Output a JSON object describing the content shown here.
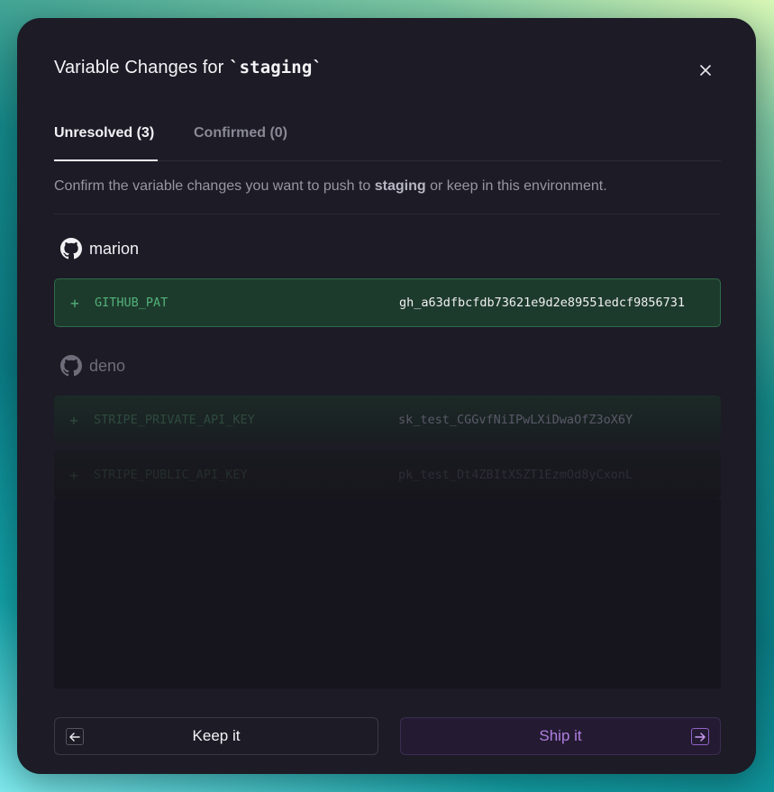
{
  "modal": {
    "title_prefix": "Variable Changes for ",
    "env_name": "`staging`",
    "close_label": "×"
  },
  "tabs": [
    {
      "label": "Unresolved (3)",
      "active": true
    },
    {
      "label": "Confirmed (0)",
      "active": false
    }
  ],
  "description": {
    "before": "Confirm the variable changes you want to push to ",
    "env": "staging",
    "after": " or keep in this environment."
  },
  "groups": [
    {
      "owner": "marion",
      "icon": "github-icon",
      "variables": [
        {
          "sign": "+",
          "key": "GITHUB_PAT",
          "value": "gh_a63dfbcfdb73621e9d2e89551edcf9856731"
        }
      ]
    },
    {
      "owner": "deno",
      "icon": "github-icon",
      "variables": [
        {
          "sign": "+",
          "key": "STRIPE_PRIVATE_API_KEY",
          "value": "sk_test_CGGvfNiIPwLXiDwaOfZ3oX6Y"
        },
        {
          "sign": "+",
          "key": "STRIPE_PUBLIC_API_KEY",
          "value": "pk_test_Dt4ZBItXSZT1EzmOd8yCxonL"
        }
      ]
    }
  ],
  "footer": {
    "keep_label": "Keep it",
    "ship_label": "Ship it",
    "keep_icon": "arrow-left-icon",
    "ship_icon": "arrow-right-icon"
  },
  "colors": {
    "accent_green": "#52b07a",
    "accent_purple": "#b07fe0"
  }
}
